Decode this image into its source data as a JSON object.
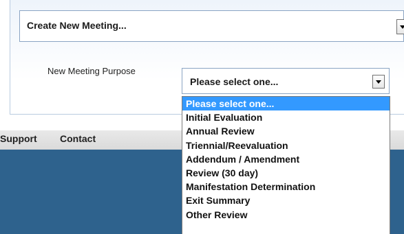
{
  "meeting_select": {
    "value": "Create New Meeting..."
  },
  "purpose": {
    "label": "New Meeting Purpose",
    "value": "Please select one...",
    "options": [
      "Please select one...",
      "Initial Evaluation",
      "Annual Review",
      "Triennial/Reevaluation",
      "Addendum / Amendment",
      "Review (30 day)",
      "Manifestation Determination",
      "Exit Summary",
      "Other Review"
    ],
    "highlighted_index": 0
  },
  "nav": {
    "support": "Support",
    "contact": "Contact"
  },
  "colors": {
    "highlight": "#3399ff",
    "footer_blue": "#2e628d"
  }
}
